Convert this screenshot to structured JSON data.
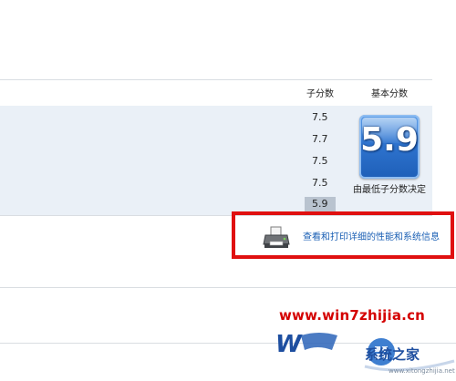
{
  "table": {
    "col_subscore": "子分数",
    "col_basescore": "基本分数",
    "subscores": [
      "7.5",
      "7.7",
      "7.5",
      "7.5",
      "5.9"
    ],
    "base_score": "5.9",
    "base_caption": "由最低子分数决定"
  },
  "print_link": "查看和打印详细的性能和系统信息",
  "watermark": {
    "url": "www.win7zhijia.cn",
    "brand": "系统之家",
    "sub": "www.xitongzhijia.net"
  },
  "colors": {
    "highlight_border": "#e01010",
    "link": "#1a5fb4",
    "badge": "#2f74cf"
  },
  "icons": [
    "printer-icon",
    "windows-logo-icon"
  ]
}
